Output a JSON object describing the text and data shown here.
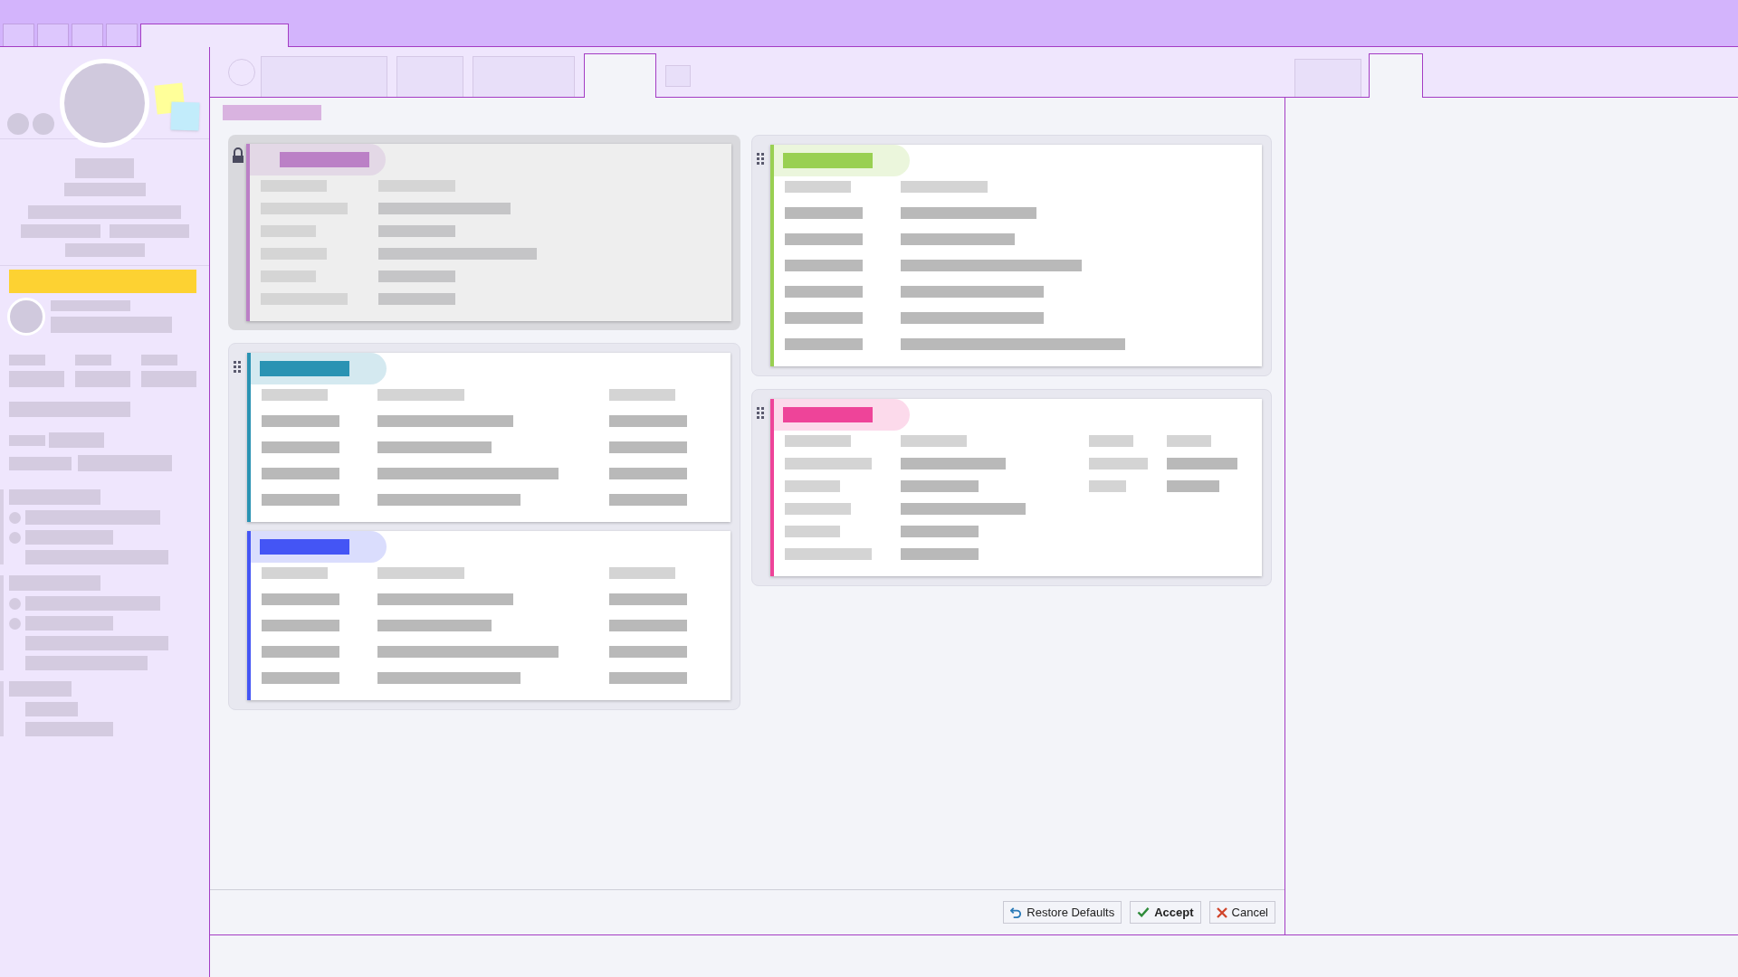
{
  "top_tabs": [
    {
      "selected": false
    },
    {
      "selected": false
    },
    {
      "selected": false
    },
    {
      "selected": false
    },
    {
      "selected": true
    }
  ],
  "view_tabs": [
    {
      "selected": false
    },
    {
      "selected": false
    },
    {
      "selected": false
    },
    {
      "selected": true
    }
  ],
  "side_tabs": [
    {
      "selected": false
    },
    {
      "selected": true
    }
  ],
  "columns": [
    {
      "groups": [
        {
          "locked": true,
          "cards": [
            {
              "kind": "list",
              "color": "#bb80c6"
            }
          ]
        },
        {
          "locked": false,
          "cards": [
            {
              "kind": "table",
              "color": "#2a93b3"
            },
            {
              "kind": "table",
              "color": "#4455f5"
            }
          ]
        }
      ]
    },
    {
      "groups": [
        {
          "locked": false,
          "cards": [
            {
              "kind": "long-list",
              "color": "#99d052"
            }
          ]
        },
        {
          "locked": false,
          "cards": [
            {
              "kind": "grid",
              "color": "#ee4499"
            }
          ]
        }
      ]
    }
  ],
  "buttons": [
    {
      "kind": "restore",
      "label": "Restore Defaults"
    },
    {
      "kind": "accept",
      "label": "Accept"
    },
    {
      "kind": "cancel",
      "label": "Cancel"
    }
  ]
}
